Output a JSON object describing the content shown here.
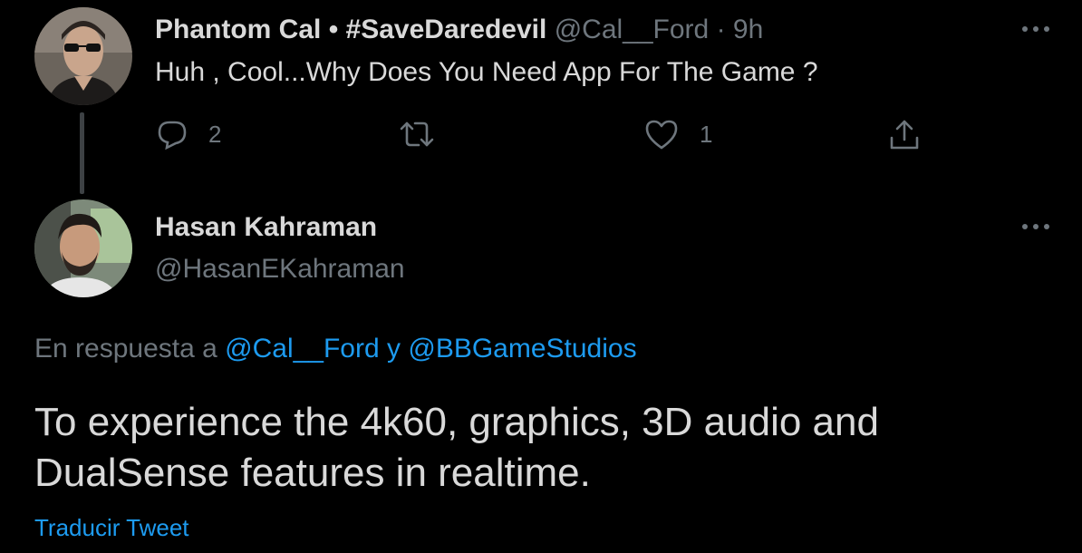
{
  "tweet1": {
    "display_name": "Phantom Cal • #SaveDaredevil",
    "handle": "@Cal__Ford",
    "separator": "·",
    "time": "9h",
    "text": "Huh , Cool...Why Does You Need App For The Game ?",
    "reply_count": "2",
    "like_count": "1"
  },
  "tweet2": {
    "display_name": "Hasan Kahraman",
    "handle": "@HasanEKahraman",
    "reply_prefix": "En respuesta a",
    "reply_user_1": "@Cal__Ford",
    "reply_connector": "y",
    "reply_user_2": "@BBGameStudios",
    "text": "To experience the 4k60, graphics, 3D audio and DualSense features in realtime.",
    "translate_label": "Traducir Tweet"
  },
  "colors": {
    "background": "#000000",
    "text": "#d9d9d9",
    "muted": "#6e767d",
    "link": "#1d9bf0",
    "thread_line": "#3d4144"
  },
  "icons": [
    "more-icon",
    "reply-icon",
    "retweet-icon",
    "like-icon",
    "share-icon"
  ]
}
